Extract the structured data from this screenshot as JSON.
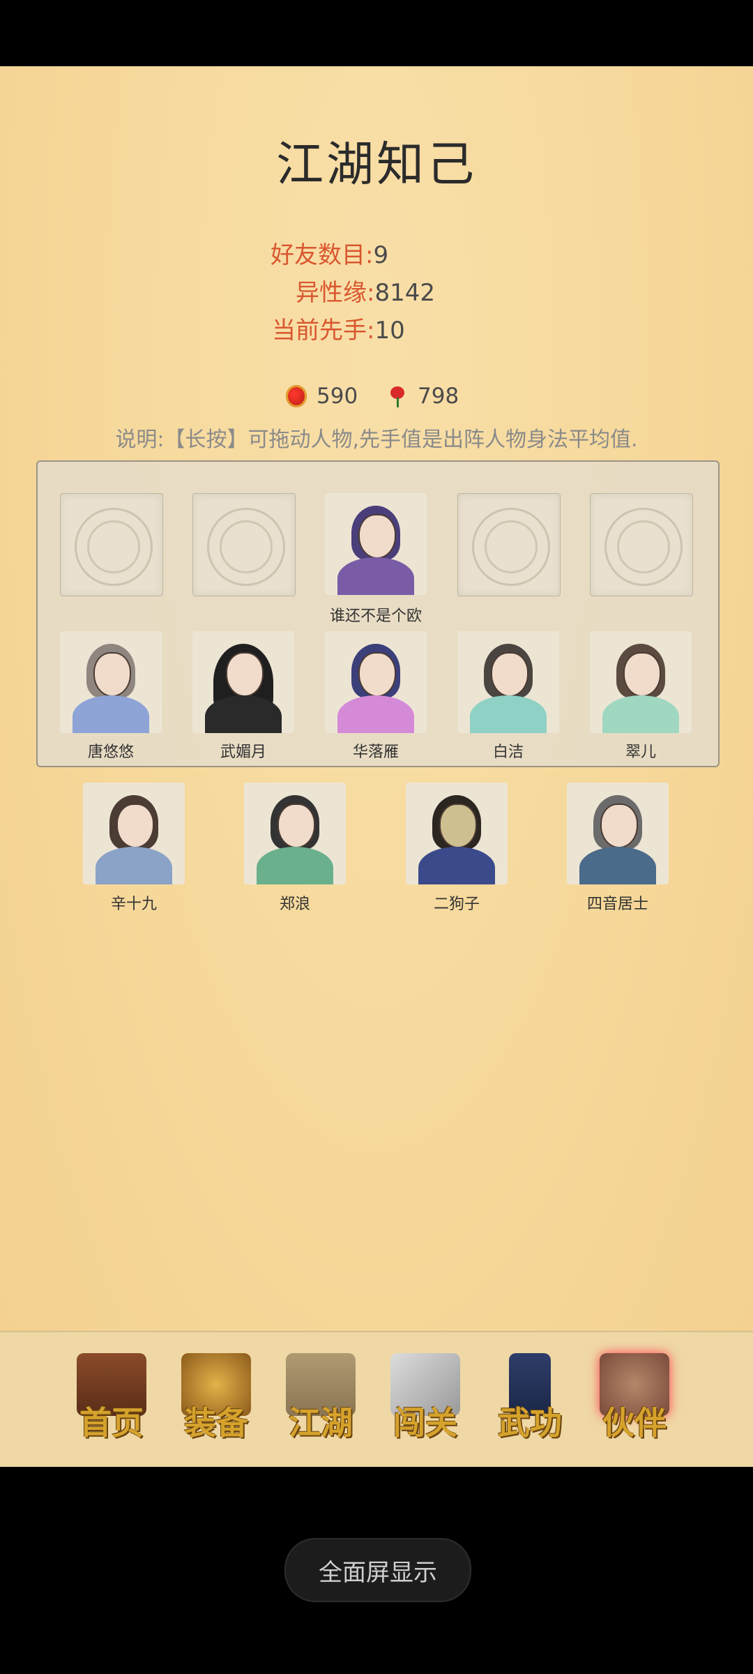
{
  "title": "江湖知己",
  "stats": {
    "friends": {
      "label": "好友数目:",
      "value": "9"
    },
    "affinity": {
      "label": "异性缘:",
      "value": "8142"
    },
    "initiative": {
      "label": "当前先手:",
      "value": "10"
    }
  },
  "currency": {
    "gourd": {
      "icon": "gourd-icon",
      "value": "590"
    },
    "rose": {
      "icon": "rose-icon",
      "value": "798"
    }
  },
  "note": "说明:【长按】可拖动人物,先手值是出阵人物身法平均值.",
  "team_slots": [
    {
      "empty": true
    },
    {
      "empty": true
    },
    {
      "empty": false,
      "name": "谁还不是个欧"
    },
    {
      "empty": true
    },
    {
      "empty": true
    }
  ],
  "panel_roster": [
    "唐悠悠",
    "武媚月",
    "华落雁",
    "白洁",
    "翠儿"
  ],
  "extra_roster": [
    "辛十九",
    "郑浪",
    "二狗子",
    "四音居士"
  ],
  "nav": [
    {
      "label": "首页",
      "icon": "house-icon"
    },
    {
      "label": "装备",
      "icon": "armor-icon"
    },
    {
      "label": "江湖",
      "icon": "scroll-icon"
    },
    {
      "label": "闯关",
      "icon": "crossed-swords-icon"
    },
    {
      "label": "武功",
      "icon": "book-icon"
    },
    {
      "label": "伙伴",
      "icon": "companions-icon"
    }
  ],
  "fullscreen_button": "全面屏显示",
  "colors": {
    "label_red": "#d9572f",
    "parchment": "#f6d89a",
    "nav_gold": "#d5a22c"
  }
}
